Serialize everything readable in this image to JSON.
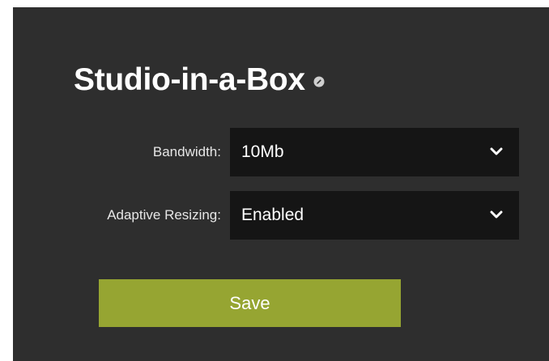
{
  "card": {
    "title": "Studio-in-a-Box",
    "edit_icon": "edit-pencil-icon"
  },
  "fields": {
    "bandwidth": {
      "label": "Bandwidth:",
      "value": "10Mb",
      "icon": "chevron-down-icon"
    },
    "adaptive_resizing": {
      "label": "Adaptive Resizing:",
      "value": "Enabled",
      "icon": "chevron-down-icon"
    }
  },
  "actions": {
    "save_label": "Save"
  },
  "colors": {
    "panel_background": "#2e2e2e",
    "select_background": "#151515",
    "save_button": "#96a532",
    "text": "#ffffff"
  }
}
